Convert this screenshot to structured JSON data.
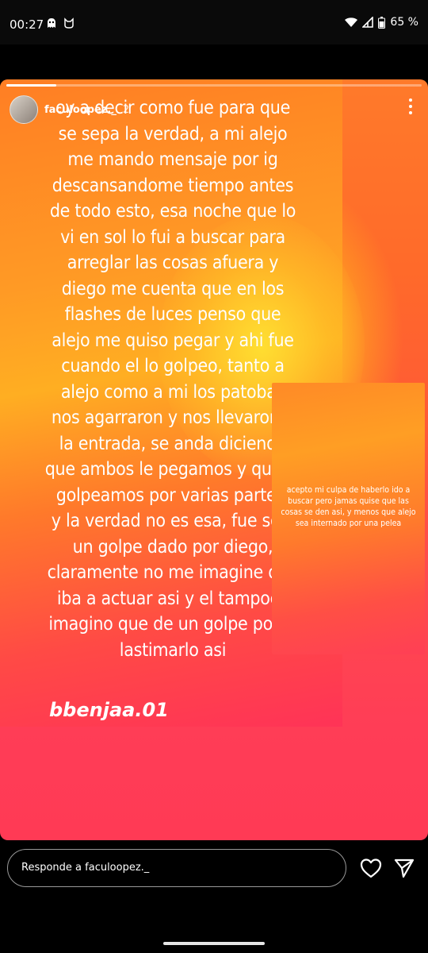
{
  "status_bar": {
    "time": "00:27",
    "battery": "65 %",
    "icons": [
      "ghost-icon",
      "cat-icon",
      "wifi-icon",
      "signal-icon",
      "battery-icon"
    ]
  },
  "story": {
    "progress": 0.12,
    "username": "faculoopez._",
    "time_ago": "2",
    "main_text": "oy a decir como fue para que\nse sepa la verdad, a mi alejo\nme mando mensaje por ig\ndescansandome tiempo antes\nde todo esto, esa noche que lo\nvi en sol lo fui a buscar para\narreglar las cosas afuera y\ndiego me cuenta que en los\nflashes de luces penso que\nalejo me quiso pegar y ahi fue\ncuando el lo golpeo, tanto a\nalejo como a mi los patobas\nnos agarraron y nos llevaron a\nla entrada, se anda diciendo\nque ambos le pegamos y que lo\ngolpeamos por varias partes,\ny la verdad no es esa, fue solo\nun golpe dado por diego,\nclaramente no me imagine que\niba a actuar asi y el tampoco\nimagino que de un golpe podia\nlastimarlo asi",
    "mention": "bbenjaa.01",
    "side_text": "acepto mi culpa de haberlo ido a buscar pero jamas quise que las cosas se den asi, y menos que alejo sea internado por una pelea"
  },
  "reply": {
    "placeholder": "Responde a faculoopez._"
  },
  "colors": {
    "accent_orange": "#ff8a26",
    "accent_pink": "#ff3a55"
  }
}
